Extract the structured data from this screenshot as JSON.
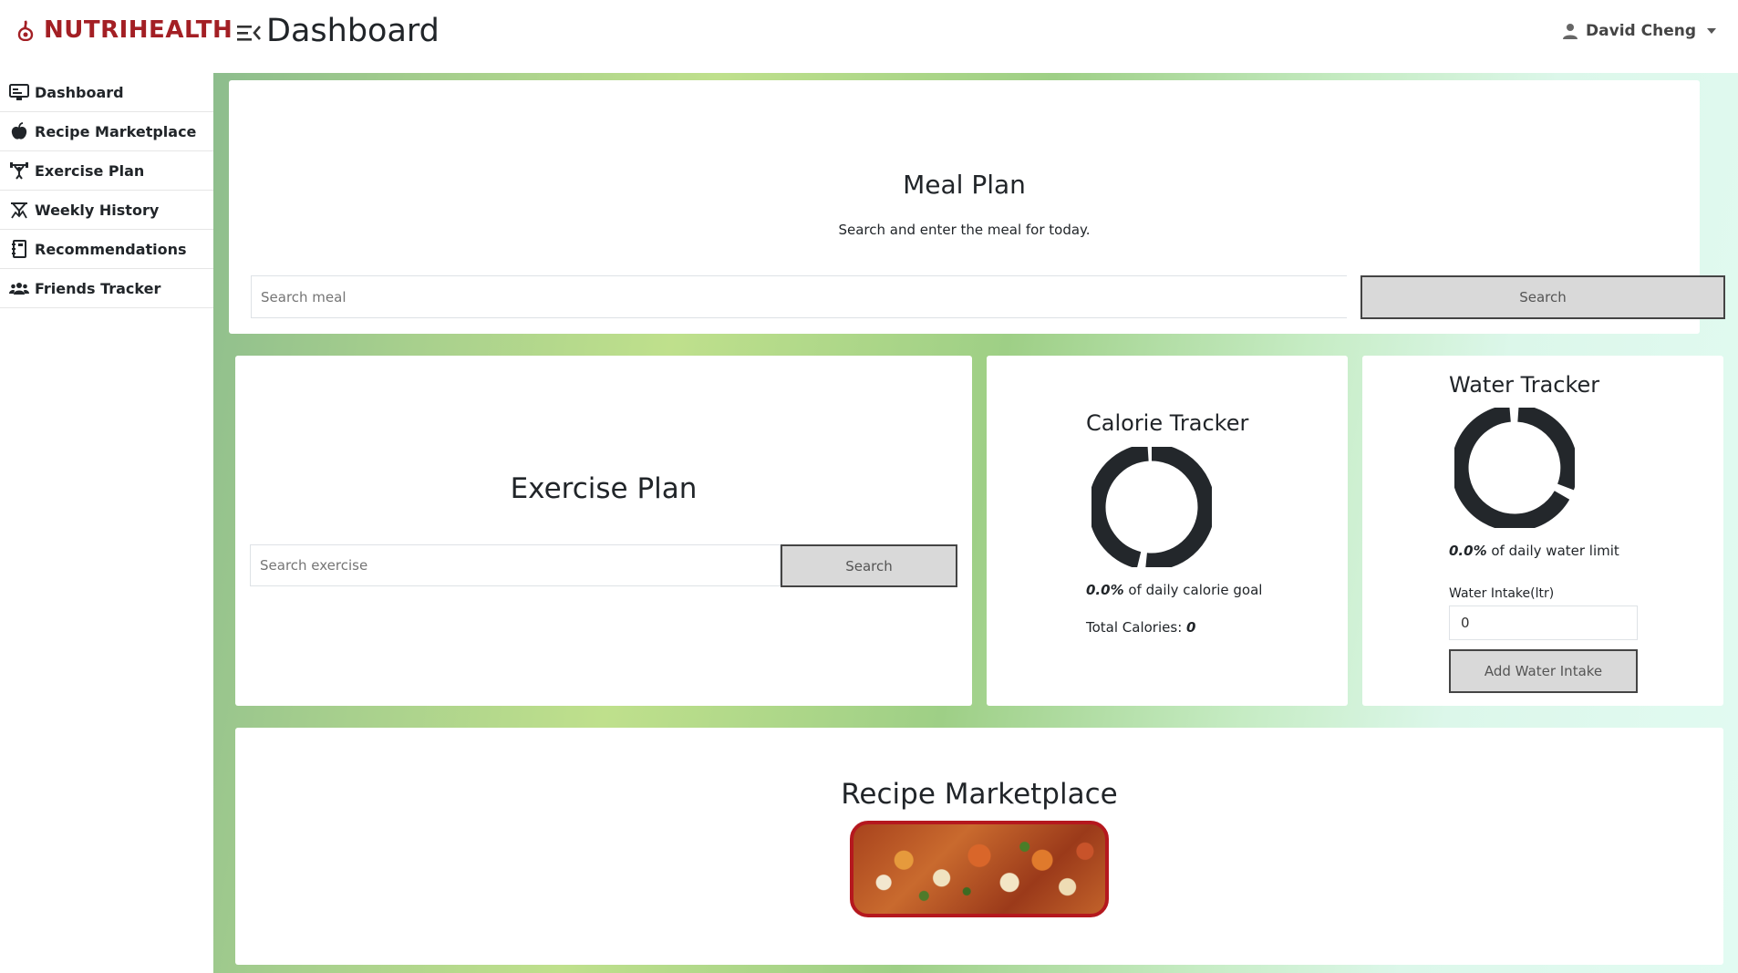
{
  "brand": {
    "name": "NUTRIHEALTH",
    "color": "#a31f24"
  },
  "header": {
    "title": "Dashboard",
    "user_name": "David Cheng"
  },
  "sidebar": {
    "items": [
      {
        "label": "Dashboard",
        "icon": "monitor-icon"
      },
      {
        "label": "Recipe Marketplace",
        "icon": "apple-icon"
      },
      {
        "label": "Exercise Plan",
        "icon": "weightlifter-icon"
      },
      {
        "label": "Weekly History",
        "icon": "history-icon"
      },
      {
        "label": "Recommendations",
        "icon": "notebook-icon"
      },
      {
        "label": "Friends Tracker",
        "icon": "users-icon"
      }
    ]
  },
  "meal_plan": {
    "title": "Meal Plan",
    "subtitle": "Search and enter the meal for today.",
    "search_placeholder": "Search meal",
    "search_button": "Search"
  },
  "exercise_plan": {
    "title": "Exercise Plan",
    "search_placeholder": "Search exercise",
    "search_button": "Search"
  },
  "calorie_tracker": {
    "title": "Calorie Tracker",
    "percent": "0.0%",
    "percent_suffix": " of daily calorie goal",
    "total_label": "Total Calories: ",
    "total_value": "0"
  },
  "water_tracker": {
    "title": "Water Tracker",
    "percent": "0.0%",
    "percent_suffix": " of daily water limit",
    "intake_label": "Water Intake(ltr)",
    "intake_value": "0",
    "add_button": "Add Water Intake"
  },
  "recipe_marketplace": {
    "title": "Recipe Marketplace"
  },
  "colors": {
    "donut": "#23272b",
    "accent_red": "#b5181e"
  }
}
